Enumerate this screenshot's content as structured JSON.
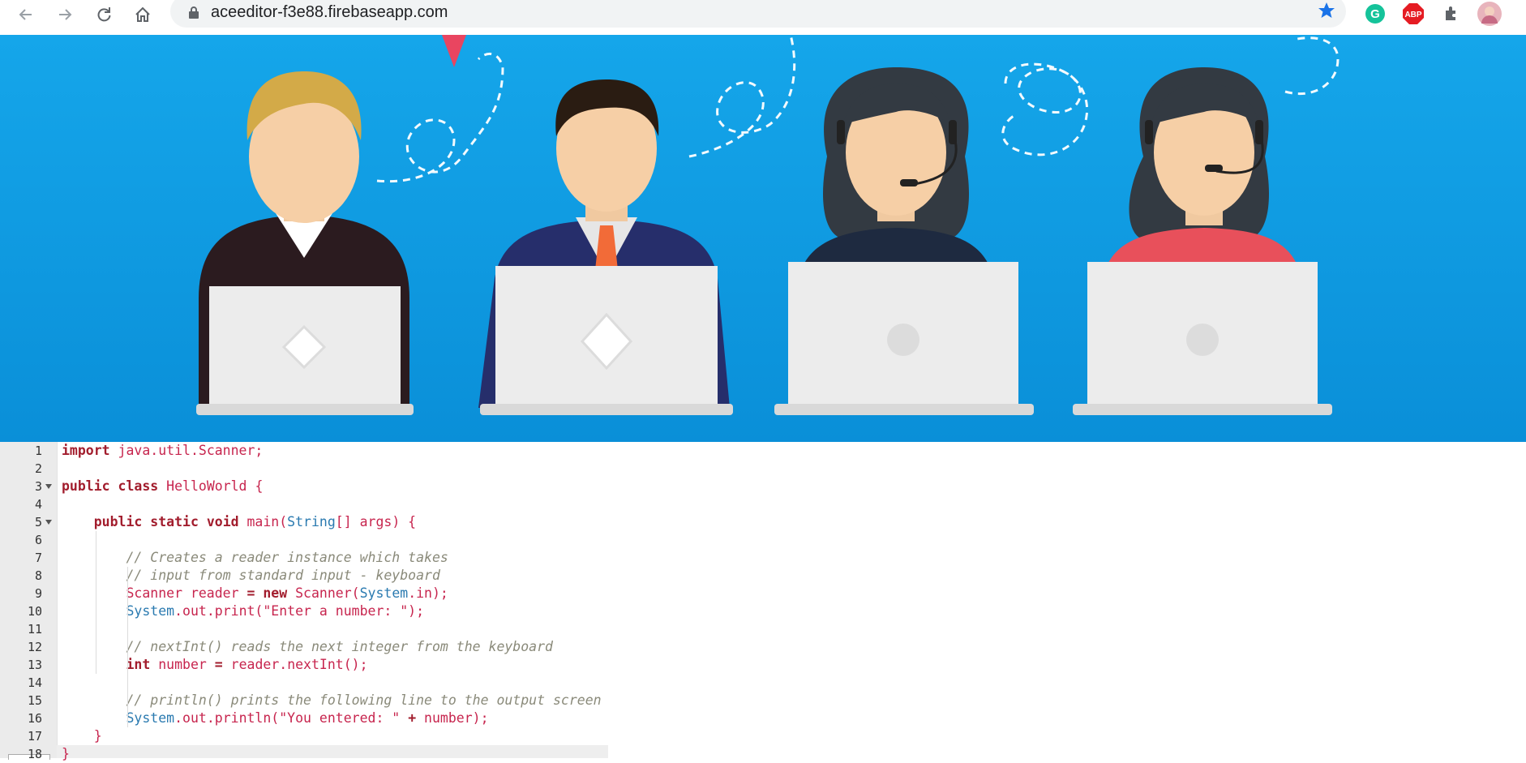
{
  "browser": {
    "url": "aceeditor-f3e88.firebaseapp.com",
    "icons": [
      "back-arrow-icon",
      "forward-arrow-icon",
      "reload-icon",
      "home-icon",
      "lock-icon",
      "star-icon",
      "grammarly-icon",
      "adblock-plus-icon",
      "extensions-puzzle-icon",
      "profile-avatar"
    ],
    "abp_label": "ABP",
    "star_color": "#1a73e8"
  },
  "banner": {
    "background": "#0ea0e4",
    "figures": [
      "woman-blonde-laptop",
      "man-tie-laptop",
      "woman-headset-laptop",
      "woman-red-headset-laptop"
    ]
  },
  "editor": {
    "line_numbers": [
      "1",
      "2",
      "3",
      "4",
      "5",
      "6",
      "7",
      "8",
      "9",
      "10",
      "11",
      "12",
      "13",
      "14",
      "15",
      "16",
      "17",
      "18"
    ],
    "lines": [
      {
        "parts": [
          [
            "kw",
            "import"
          ],
          [
            "plain",
            " java.util.Scanner;"
          ]
        ]
      },
      {
        "parts": []
      },
      {
        "parts": [
          [
            "kw",
            "public class"
          ],
          [
            "plain",
            " HelloWorld "
          ],
          [
            "plain",
            "{"
          ]
        ]
      },
      {
        "parts": []
      },
      {
        "parts": [
          [
            "plain",
            "    "
          ],
          [
            "kw",
            "public static void"
          ],
          [
            "plain",
            " main("
          ],
          [
            "cls",
            "String"
          ],
          [
            "plain",
            "[] args) {"
          ]
        ]
      },
      {
        "parts": []
      },
      {
        "parts": [
          [
            "plain",
            "        "
          ],
          [
            "cmt",
            "// Creates a reader instance which takes"
          ]
        ]
      },
      {
        "parts": [
          [
            "plain",
            "        "
          ],
          [
            "cmt",
            "// input from standard input - keyboard"
          ]
        ]
      },
      {
        "parts": [
          [
            "plain",
            "        Scanner reader "
          ],
          [
            "kw",
            "="
          ],
          [
            "plain",
            " "
          ],
          [
            "kw",
            "new"
          ],
          [
            "plain",
            " Scanner("
          ],
          [
            "cls",
            "System"
          ],
          [
            "plain",
            ".in);"
          ]
        ]
      },
      {
        "parts": [
          [
            "plain",
            "        "
          ],
          [
            "cls",
            "System"
          ],
          [
            "plain",
            ".out.print(\"Enter a number: \");"
          ]
        ]
      },
      {
        "parts": []
      },
      {
        "parts": [
          [
            "plain",
            "        "
          ],
          [
            "cmt",
            "// nextInt() reads the next integer from the keyboard"
          ]
        ]
      },
      {
        "parts": [
          [
            "plain",
            "        "
          ],
          [
            "kw",
            "int"
          ],
          [
            "plain",
            " number "
          ],
          [
            "kw",
            "="
          ],
          [
            "plain",
            " reader.nextInt();"
          ]
        ]
      },
      {
        "parts": []
      },
      {
        "parts": [
          [
            "plain",
            "        "
          ],
          [
            "cmt",
            "// println() prints the following line to the output screen"
          ]
        ]
      },
      {
        "parts": [
          [
            "plain",
            "        "
          ],
          [
            "cls",
            "System"
          ],
          [
            "plain",
            ".out.println(\"You entered: \" "
          ],
          [
            "kw",
            "+"
          ],
          [
            "plain",
            " number);"
          ]
        ]
      },
      {
        "parts": [
          [
            "plain",
            "    }"
          ]
        ]
      },
      {
        "parts": [
          [
            "plain",
            "}"
          ]
        ]
      }
    ],
    "folds": [
      "3",
      "5"
    ]
  }
}
